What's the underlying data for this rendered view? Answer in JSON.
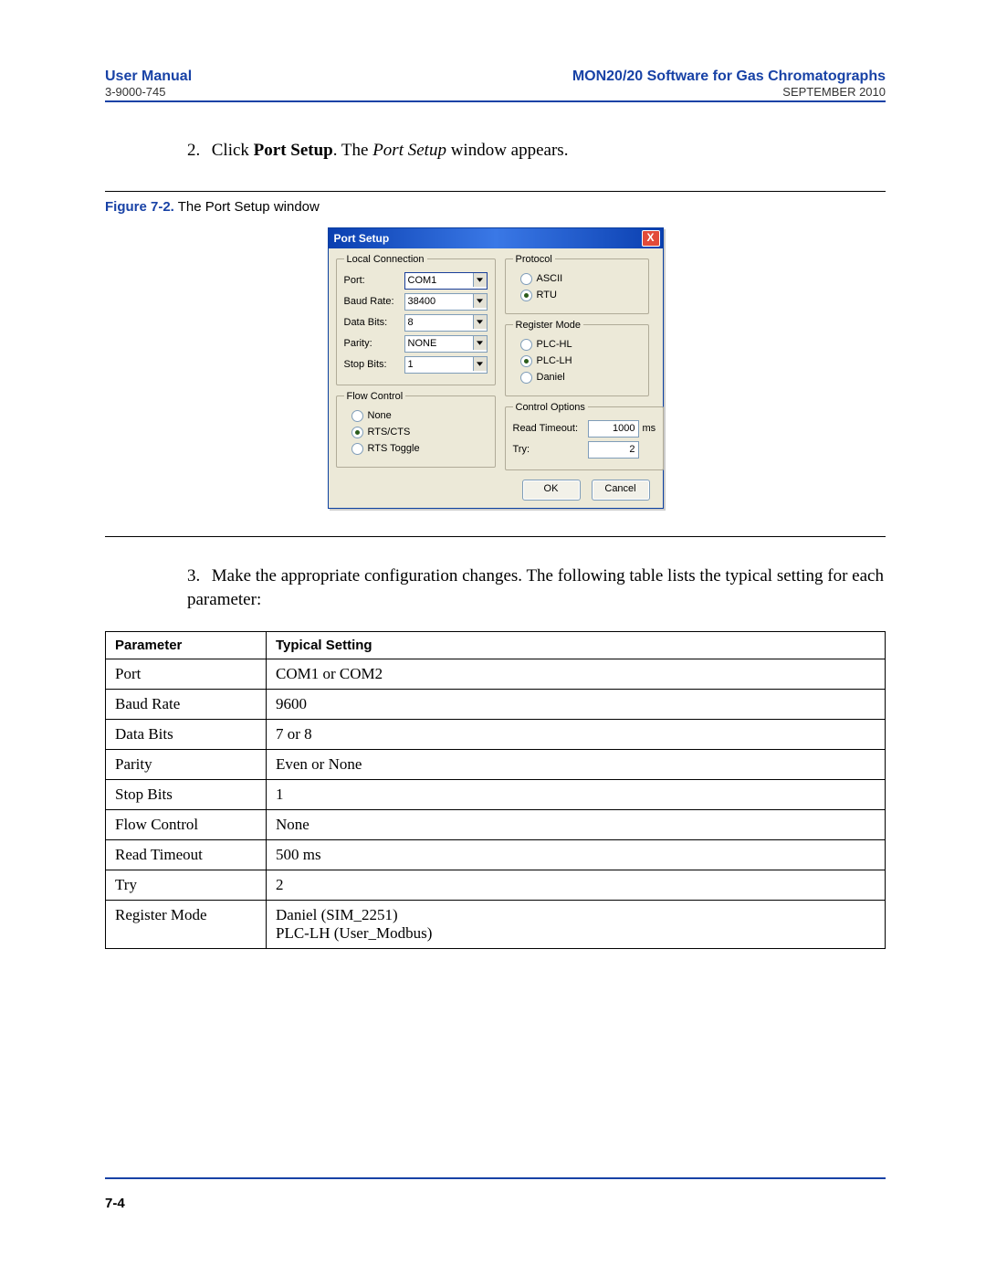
{
  "header": {
    "left": "User Manual",
    "right": "MON20/20 Software for Gas Chromatographs",
    "doc_num": "3-9000-745",
    "date": "SEPTEMBER 2010"
  },
  "step2": {
    "num": "2.",
    "pre": "Click ",
    "bold": "Port Setup",
    "mid": ".  The ",
    "italic": "Port Setup",
    "post": " window appears."
  },
  "figure": {
    "label": "Figure 7-2.",
    "caption": "  The Port Setup window"
  },
  "dialog": {
    "title": "Port Setup",
    "close": "X",
    "local": {
      "legend": "Local Connection",
      "port_lbl": "Port:",
      "port": "COM1",
      "baud_lbl": "Baud Rate:",
      "baud": "38400",
      "data_lbl": "Data Bits:",
      "data": "8",
      "parity_lbl": "Parity:",
      "parity": "NONE",
      "stop_lbl": "Stop Bits:",
      "stop": "1"
    },
    "flow": {
      "legend": "Flow Control",
      "opts": [
        "None",
        "RTS/CTS",
        "RTS Toggle"
      ],
      "selected": 1
    },
    "protocol": {
      "legend": "Protocol",
      "opts": [
        "ASCII",
        "RTU"
      ],
      "selected": 1
    },
    "regmode": {
      "legend": "Register Mode",
      "opts": [
        "PLC-HL",
        "PLC-LH",
        "Daniel"
      ],
      "selected": 1
    },
    "ctrl": {
      "legend": "Control Options",
      "rt_lbl": "Read Timeout:",
      "rt_val": "1000",
      "rt_unit": "ms",
      "try_lbl": "Try:",
      "try_val": "2"
    },
    "ok": "OK",
    "cancel": "Cancel"
  },
  "step3": {
    "num": "3.",
    "text": "Make the appropriate configuration changes.  The following table lists the typical setting for each parameter:"
  },
  "table": {
    "h1": "Parameter",
    "h2": "Typical Setting",
    "rows": [
      {
        "p": "Port",
        "v": "COM1 or COM2"
      },
      {
        "p": "Baud Rate",
        "v": "9600"
      },
      {
        "p": "Data Bits",
        "v": "7 or 8"
      },
      {
        "p": "Parity",
        "v": "Even or None"
      },
      {
        "p": "Stop Bits",
        "v": "1"
      },
      {
        "p": "Flow Control",
        "v": "None"
      },
      {
        "p": "Read Timeout",
        "v": "500 ms"
      },
      {
        "p": "Try",
        "v": "2"
      },
      {
        "p": "Register Mode",
        "v": "Daniel (SIM_2251)\nPLC-LH (User_Modbus)"
      }
    ]
  },
  "footer": {
    "page": "7-4"
  }
}
